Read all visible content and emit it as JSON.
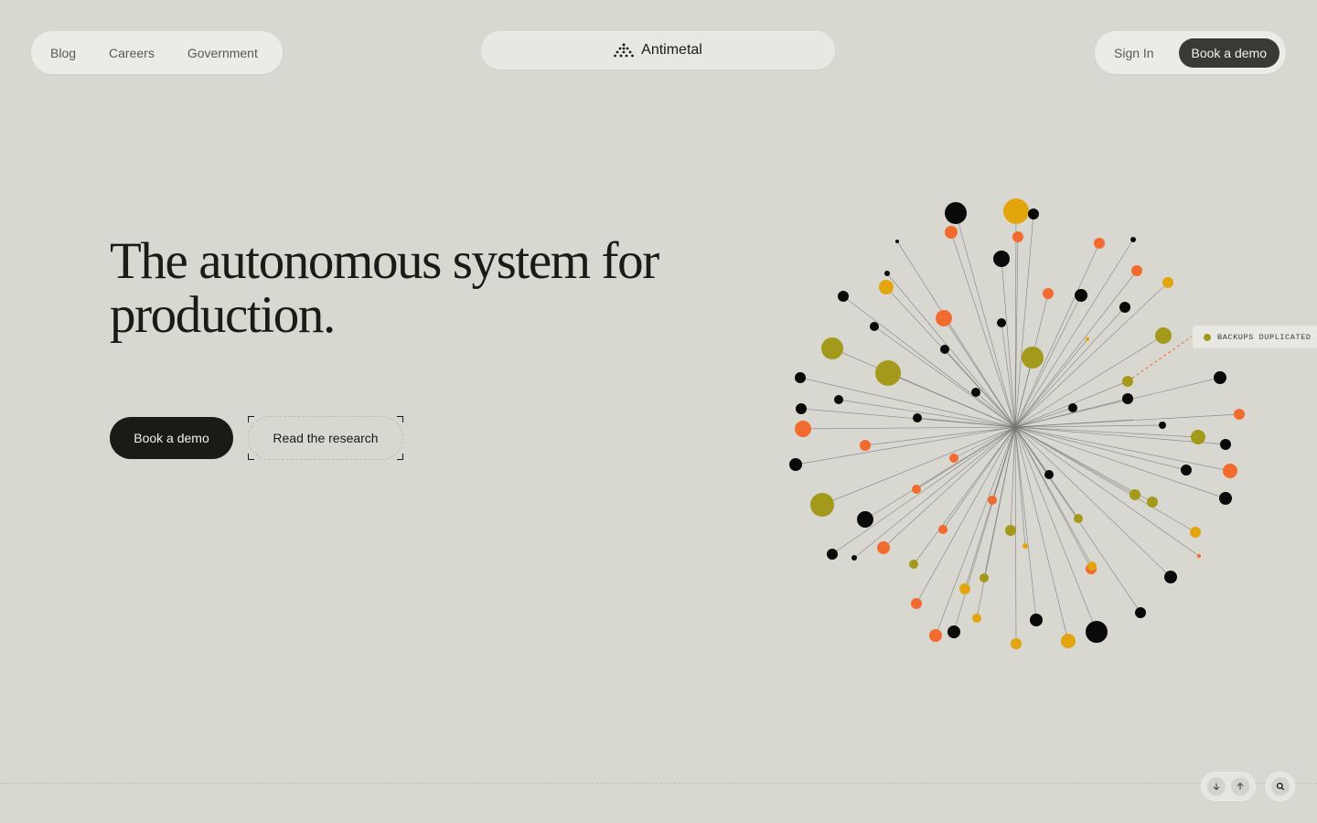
{
  "nav": {
    "left_links": [
      "Blog",
      "Careers",
      "Government"
    ],
    "brand": "Antimetal",
    "sign_in": "Sign In",
    "book_demo": "Book a demo"
  },
  "hero": {
    "headline_line1": "The autonomous system for",
    "headline_line2": "production.",
    "cta_primary": "Book a demo",
    "cta_secondary": "Read the research"
  },
  "visualization": {
    "tag_label": "BACKUPS DUPLICATED",
    "colors": {
      "black": "#0a0a0a",
      "orange": "#f26b2e",
      "gold": "#e3a50c",
      "olive": "#a39a1c",
      "line": "#777570"
    }
  },
  "controls": {
    "scroll_down_icon": "arrow-down-icon",
    "scroll_up_icon": "arrow-up-icon",
    "search_icon": "search-icon"
  }
}
